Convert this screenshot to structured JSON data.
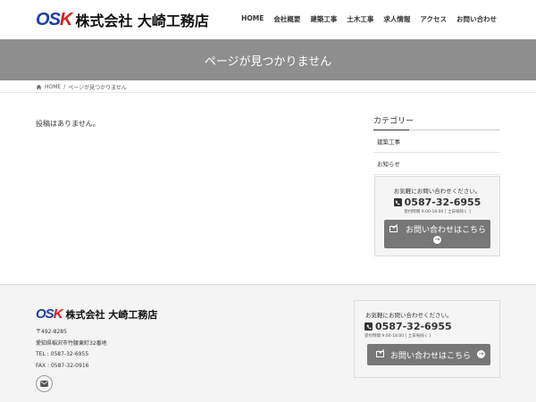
{
  "header": {
    "logo_mark": {
      "o": "O",
      "s": "S",
      "k": "K"
    },
    "company_name": "株式会社 大崎工務店",
    "nav": [
      "HOME",
      "会社概要",
      "建築工事",
      "土木工事",
      "求人情報",
      "アクセス",
      "お問い合わせ"
    ]
  },
  "banner": {
    "title": "ページが見つかりません"
  },
  "breadcrumb": {
    "home": "HOME",
    "separator": "/",
    "current": "ページが見つかりません"
  },
  "main": {
    "message": "投稿はありません。"
  },
  "sidebar": {
    "category_title": "カテゴリー",
    "categories": [
      "建築工事",
      "お知らせ"
    ]
  },
  "contact": {
    "message": "お気軽にお問い合わせください。",
    "tel": "0587-32-6955",
    "hours": "受付時間 9:00-18:00 [ 土日祝除く ]",
    "button_label": "お問い合わせはこちら"
  },
  "footer": {
    "company_name": "株式会社 大崎工務店",
    "postal": "〒492-8285",
    "address": "愛知県稲沢市竹腰東町32番地",
    "tel": "TEL : 0587-32-6955",
    "fax": "FAX : 0587-32-0916"
  },
  "colors": {
    "brand_blue": "#1b3fa6",
    "brand_red": "#d81e1e",
    "banner_gray": "#8e8e8e",
    "button_gray": "#777777"
  }
}
